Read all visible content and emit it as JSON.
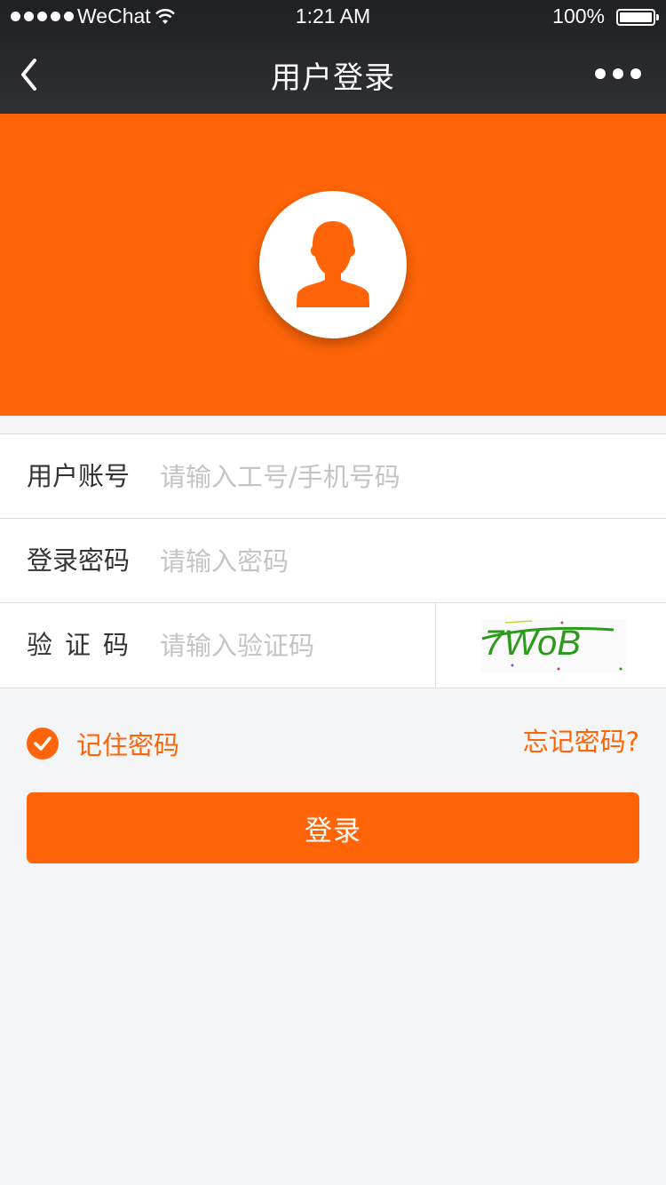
{
  "status_bar": {
    "carrier": "WeChat",
    "time": "1:21 AM",
    "battery": "100%"
  },
  "nav": {
    "title": "用户登录",
    "back_icon": "chevron-left-icon",
    "more_icon": "more-dots-icon"
  },
  "hero": {
    "color": "#ff6508",
    "avatar_icon": "user-avatar-icon"
  },
  "form": {
    "account": {
      "label": "用户账号",
      "placeholder": "请输入工号/手机号码",
      "value": ""
    },
    "password": {
      "label": "登录密码",
      "placeholder": "请输入密码",
      "value": ""
    },
    "captcha": {
      "label": "验证码",
      "placeholder": "请输入验证码",
      "value": "",
      "image_text": "7WoB"
    }
  },
  "options": {
    "remember_label": "记住密码",
    "remember_checked": true,
    "forgot_label": "忘记密码?"
  },
  "login_button": "登录",
  "colors": {
    "accent": "#ff6508",
    "background": "#f4f5f7",
    "navbar": "#2b2c30"
  }
}
